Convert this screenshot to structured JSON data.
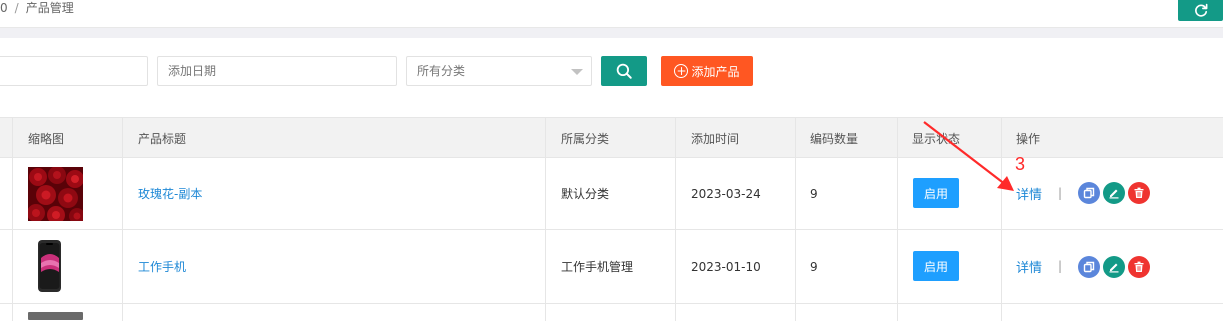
{
  "breadcrumb": {
    "prev": "0",
    "separator": "/",
    "current": "产品管理"
  },
  "colors": {
    "teal": "#139a87",
    "orange": "#ff5722",
    "blue": "#1e9fff",
    "link": "#1e88d6",
    "red_annotation": "#ff2a2a"
  },
  "filters": {
    "keyword_value": "",
    "date_placeholder": "添加日期",
    "category_selected": "所有分类",
    "search_icon": "search-icon",
    "add_button_label": "添加产品"
  },
  "table": {
    "columns": [
      "缩略图",
      "产品标题",
      "所属分类",
      "添加时间",
      "编码数量",
      "显示状态",
      "操作"
    ],
    "rows": [
      {
        "thumbnail": "roses-image",
        "title": "玫瑰花-副本",
        "category": "默认分类",
        "date": "2023-03-24",
        "code_count": "9",
        "status_label": "启用",
        "detail_label": "详情",
        "separator": "|"
      },
      {
        "thumbnail": "phone-image",
        "title": "工作手机",
        "category": "工作手机管理",
        "date": "2023-01-10",
        "code_count": "9",
        "status_label": "启用",
        "detail_label": "详情",
        "separator": "|"
      }
    ]
  },
  "annotation": {
    "number": "3"
  }
}
